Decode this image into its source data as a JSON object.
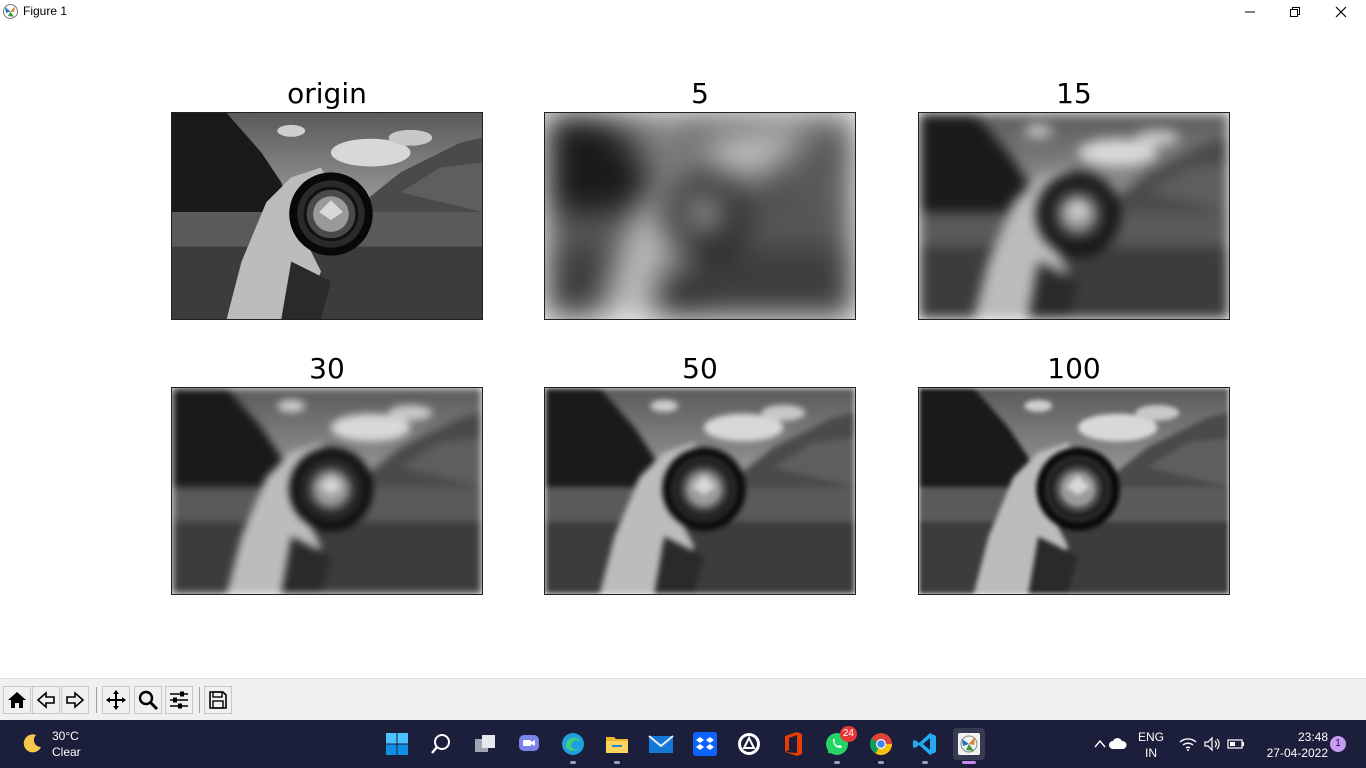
{
  "window": {
    "title": "Figure 1",
    "controls": [
      "minimize-icon",
      "restore-icon",
      "close-icon"
    ]
  },
  "figure": {
    "subplots": [
      {
        "title": "origin",
        "blur": 0
      },
      {
        "title": "5",
        "blur": 16
      },
      {
        "title": "15",
        "blur": 6
      },
      {
        "title": "30",
        "blur": 4
      },
      {
        "title": "50",
        "blur": 3
      },
      {
        "title": "100",
        "blur": 2.5
      }
    ]
  },
  "toolbar": {
    "buttons": [
      "home-icon",
      "back-icon",
      "forward-icon",
      "pan-icon",
      "zoom-icon",
      "configure-subplots-icon",
      "save-icon"
    ]
  },
  "taskbar": {
    "weather": {
      "temp": "30°C",
      "condition": "Clear",
      "icon": "moon-icon"
    },
    "apps": [
      {
        "name": "start-icon"
      },
      {
        "name": "search-icon"
      },
      {
        "name": "task-view-icon"
      },
      {
        "name": "teams-chat-icon"
      },
      {
        "name": "edge-icon"
      },
      {
        "name": "file-explorer-icon"
      },
      {
        "name": "mail-icon"
      },
      {
        "name": "dropbox-icon"
      },
      {
        "name": "app-icon"
      },
      {
        "name": "office-icon"
      },
      {
        "name": "whatsapp-icon",
        "badge": "24"
      },
      {
        "name": "chrome-icon"
      },
      {
        "name": "vscode-icon"
      },
      {
        "name": "matplotlib-figure-icon"
      }
    ],
    "tray": {
      "language_line1": "ENG",
      "language_line2": "IN",
      "time": "23:48",
      "date": "27-04-2022",
      "notifications": "1"
    }
  }
}
